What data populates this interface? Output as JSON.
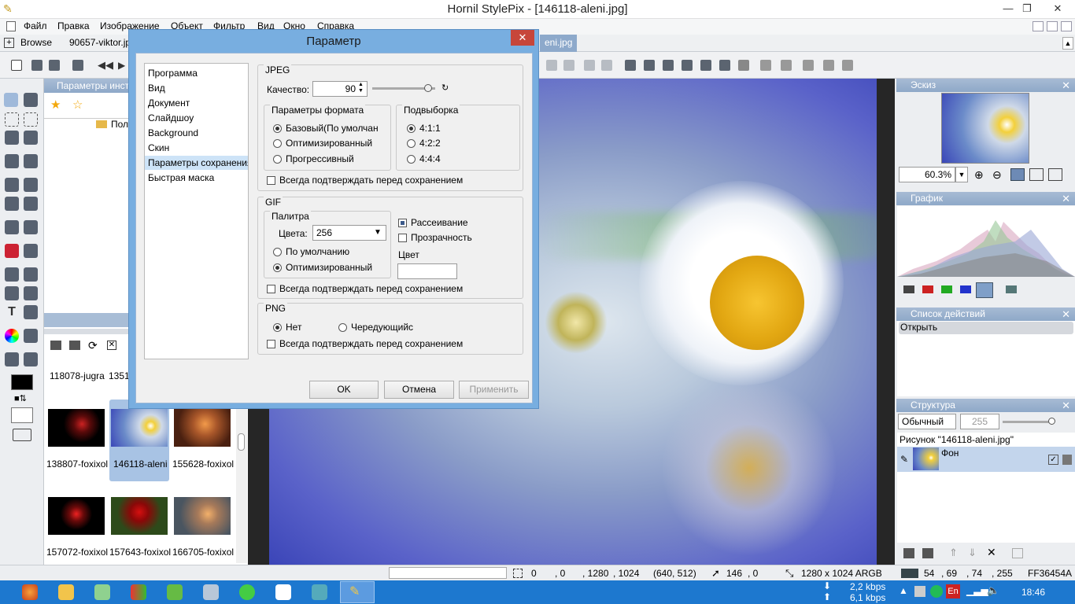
{
  "window": {
    "title": "Hornil StylePix - [146118-aleni.jpg]",
    "min": "—",
    "max": "❐",
    "close": "✕"
  },
  "menu": [
    "Файл",
    "Правка",
    "Изображение",
    "Объект",
    "Фильтр",
    "Вид",
    "Окно",
    "Справка"
  ],
  "tabs": {
    "browse": "Browse",
    "file1": "90657-viktor.jp",
    "file2": "eni.jpg"
  },
  "left_panel": {
    "title": "Параметры инст",
    "folder": "Пол"
  },
  "thumbs": [
    {
      "name": "118078-jugra"
    },
    {
      "name": "1351"
    },
    {
      "name": "138807-foxixol"
    },
    {
      "name": "146118-aleni"
    },
    {
      "name": "155628-foxixol"
    },
    {
      "name": "157072-foxixol"
    },
    {
      "name": "157643-foxixol"
    },
    {
      "name": "166705-foxixol"
    }
  ],
  "dialog": {
    "title": "Параметр",
    "close": "✕",
    "nav": [
      "Программа",
      "Вид",
      "Документ",
      "Слайдшоу",
      "Background",
      "Скин",
      "Параметры сохранения",
      "Быстрая маска"
    ],
    "selected_nav": "Параметры сохранения",
    "jpeg": {
      "title": "JPEG",
      "quality_label": "Качество:",
      "quality": "90",
      "format_title": "Параметры формата",
      "formats": [
        "Базовый(По умолчан",
        "Оптимизированный",
        "Прогрессивный"
      ],
      "subsample_title": "Подвыборка",
      "subsamples": [
        "4:1:1",
        "4:2:2",
        "4:4:4"
      ],
      "confirm": "Всегда подтверждать перед сохранением"
    },
    "gif": {
      "title": "GIF",
      "palette_title": "Палитра",
      "colors_label": "Цвета:",
      "colors": "256",
      "options": [
        "По умолчанию",
        "Оптимизированный"
      ],
      "dither": "Рассеивание",
      "transparency": "Прозрачность",
      "color_label": "Цвет",
      "confirm": "Всегда подтверждать перед сохранением"
    },
    "png": {
      "title": "PNG",
      "options": [
        "Нет",
        "Чередующийс"
      ],
      "confirm": "Всегда подтверждать перед сохранением"
    },
    "buttons": {
      "ok": "OK",
      "cancel": "Отмена",
      "apply": "Применить"
    }
  },
  "right": {
    "thumb_title": "Эскиз",
    "zoom": "60.3%",
    "graph_title": "График",
    "actions_title": "Список действий",
    "action1": "Открыть",
    "structure_title": "Структура",
    "blend": "Обычный",
    "opacity": "255",
    "picture": "Рисунок \"146118-aleni.jpg\"",
    "layer": "Фон"
  },
  "status": {
    "sel_x": "0",
    "sel_y": ", 0",
    "sel_w": ", 1280",
    "sel_h": ", 1024",
    "center": "(640, 512)",
    "cur_x": "146",
    "cur_y": ",   0",
    "size": "1280 x 1024 ARGB",
    "r": "54",
    "g": ", 69",
    "b": ", 74",
    "a": ", 255",
    "hex": "FF36454A"
  },
  "taskbar": {
    "down": "2,2 kbps",
    "up": "6,1 kbps",
    "lang": "En",
    "time": "18:46"
  }
}
